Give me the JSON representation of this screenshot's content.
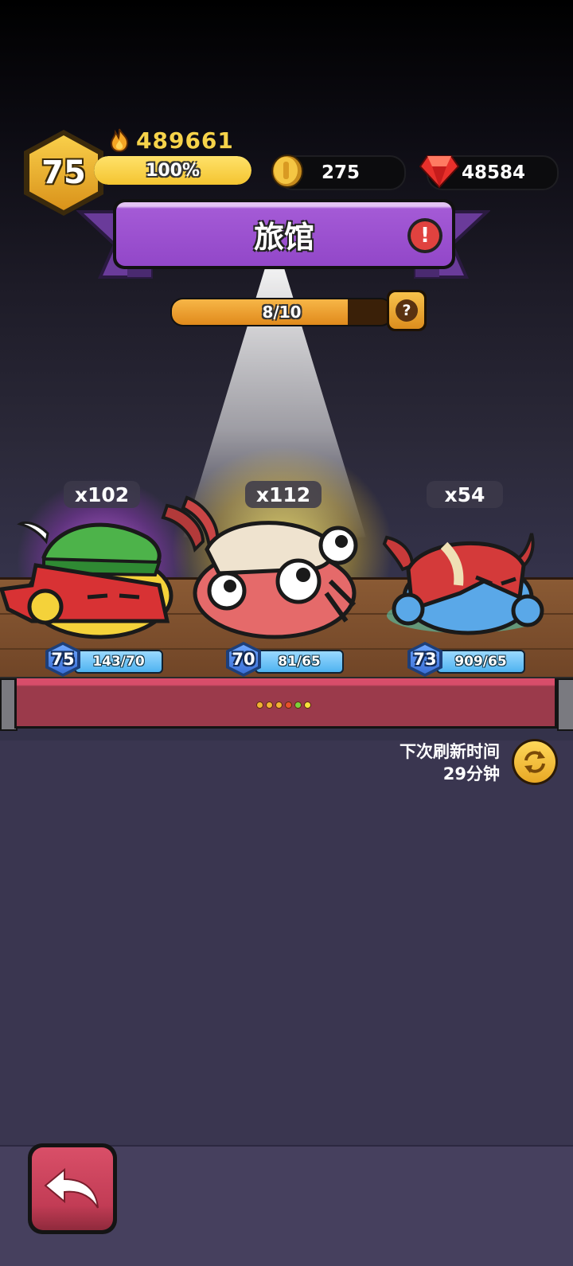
{
  "player": {
    "level": "75",
    "power": "489661",
    "xp_percent_label": "100%",
    "xp_fraction": 1.0
  },
  "currency": {
    "coins": "275",
    "gems": "48584"
  },
  "shop": {
    "title": "旅馆",
    "alert_symbol": "!",
    "progress_label": "8/10",
    "progress_fraction": 0.8,
    "help_symbol": "?"
  },
  "heroes": [
    {
      "quantity": "x102",
      "level": "75",
      "stat": "143/70",
      "aura": "purple",
      "icon": "archer-blob-green-hat-icon"
    },
    {
      "quantity": "x112",
      "level": "70",
      "stat": "81/65",
      "aura": "gold",
      "icon": "squid-blob-icon"
    },
    {
      "quantity": "x54",
      "level": "73",
      "stat": "909/65",
      "aura": "teal",
      "icon": "horned-helmet-blob-icon"
    }
  ],
  "page_dots": [
    "#f2b233",
    "#f2b233",
    "#f2b233",
    "#e8502b",
    "#7bd13b",
    "#f6e23c"
  ],
  "refresh": {
    "label_line1": "下次刷新时间",
    "label_line2": "29分钟"
  },
  "colors": {
    "banner_purple": "#9247c8",
    "gold": "#f6d34a",
    "counter_red": "#9b3a4b",
    "back_button": "#c23c55"
  }
}
